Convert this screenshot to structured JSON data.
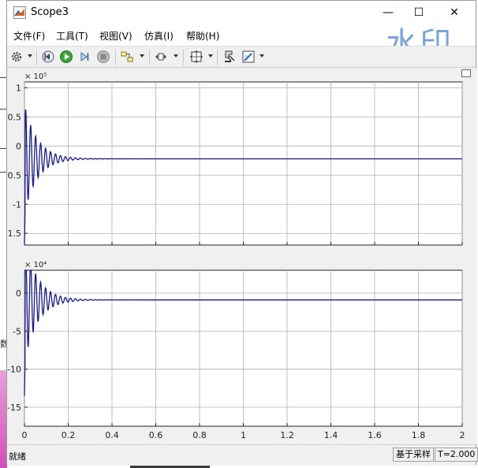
{
  "window": {
    "title": "Scope3",
    "minimize": "—",
    "maximize": "☐",
    "close": "✕"
  },
  "menu": [
    {
      "label": "文件(F)"
    },
    {
      "label": "工具(T)"
    },
    {
      "label": "视图(V)"
    },
    {
      "label": "仿真(I)"
    },
    {
      "label": "帮助(H)"
    }
  ],
  "watermark": "水印",
  "toolbar_icons": [
    "settings-icon",
    "step-back-icon",
    "run-icon",
    "step-forward-icon",
    "stop-icon",
    "signal-select-icon",
    "zoom-icon",
    "fit-to-view-icon",
    "highlight-block-icon",
    "style-icon"
  ],
  "colors": {
    "trace": "#1a1a80",
    "background": "#ffffff",
    "grid": "#b0b0b0"
  },
  "chart_data": [
    {
      "type": "line",
      "y_exponent_label": "× 10⁵",
      "xlim": [
        0,
        2
      ],
      "ylim": [
        -1.7,
        1.1
      ],
      "yticks": [
        1,
        0.5,
        0,
        -0.5,
        -1,
        -1.5
      ],
      "ytick_labels": [
        "1",
        "0.5",
        "0",
        "-0.5",
        "-1",
        "-1.5"
      ],
      "xticks": [
        0,
        0.2,
        0.4,
        0.6,
        0.8,
        1,
        1.2,
        1.4,
        1.6,
        1.8,
        2
      ],
      "grid": true,
      "series": [
        {
          "steady_value": -0.22,
          "start_value": -1.7,
          "peak_low": -1.45,
          "peak_high": 0.42,
          "decay_rate": 17,
          "freq_hz": 44
        }
      ]
    },
    {
      "type": "line",
      "y_exponent_label": "× 10⁴",
      "xlim": [
        0,
        2
      ],
      "ylim": [
        -17.5,
        3
      ],
      "yticks": [
        0,
        -5,
        -10,
        -15
      ],
      "ytick_labels": [
        "0",
        "-5",
        "-10",
        "-15"
      ],
      "xticks": [
        0,
        0.2,
        0.4,
        0.6,
        0.8,
        1,
        1.2,
        1.4,
        1.6,
        1.8,
        2
      ],
      "xtick_labels": [
        "0",
        "0.2",
        "0.4",
        "0.6",
        "0.8",
        "1",
        "1.2",
        "1.4",
        "1.6",
        "1.8",
        "2"
      ],
      "grid": true,
      "series": [
        {
          "steady_value": -0.9,
          "start_value": -13.5,
          "peak_low": -13.5,
          "peak_high": 3,
          "decay_rate": 17,
          "freq_hz": 44
        }
      ]
    }
  ],
  "status": {
    "left": "就绪",
    "mode": "基于采样",
    "time": "T=2.000"
  }
}
